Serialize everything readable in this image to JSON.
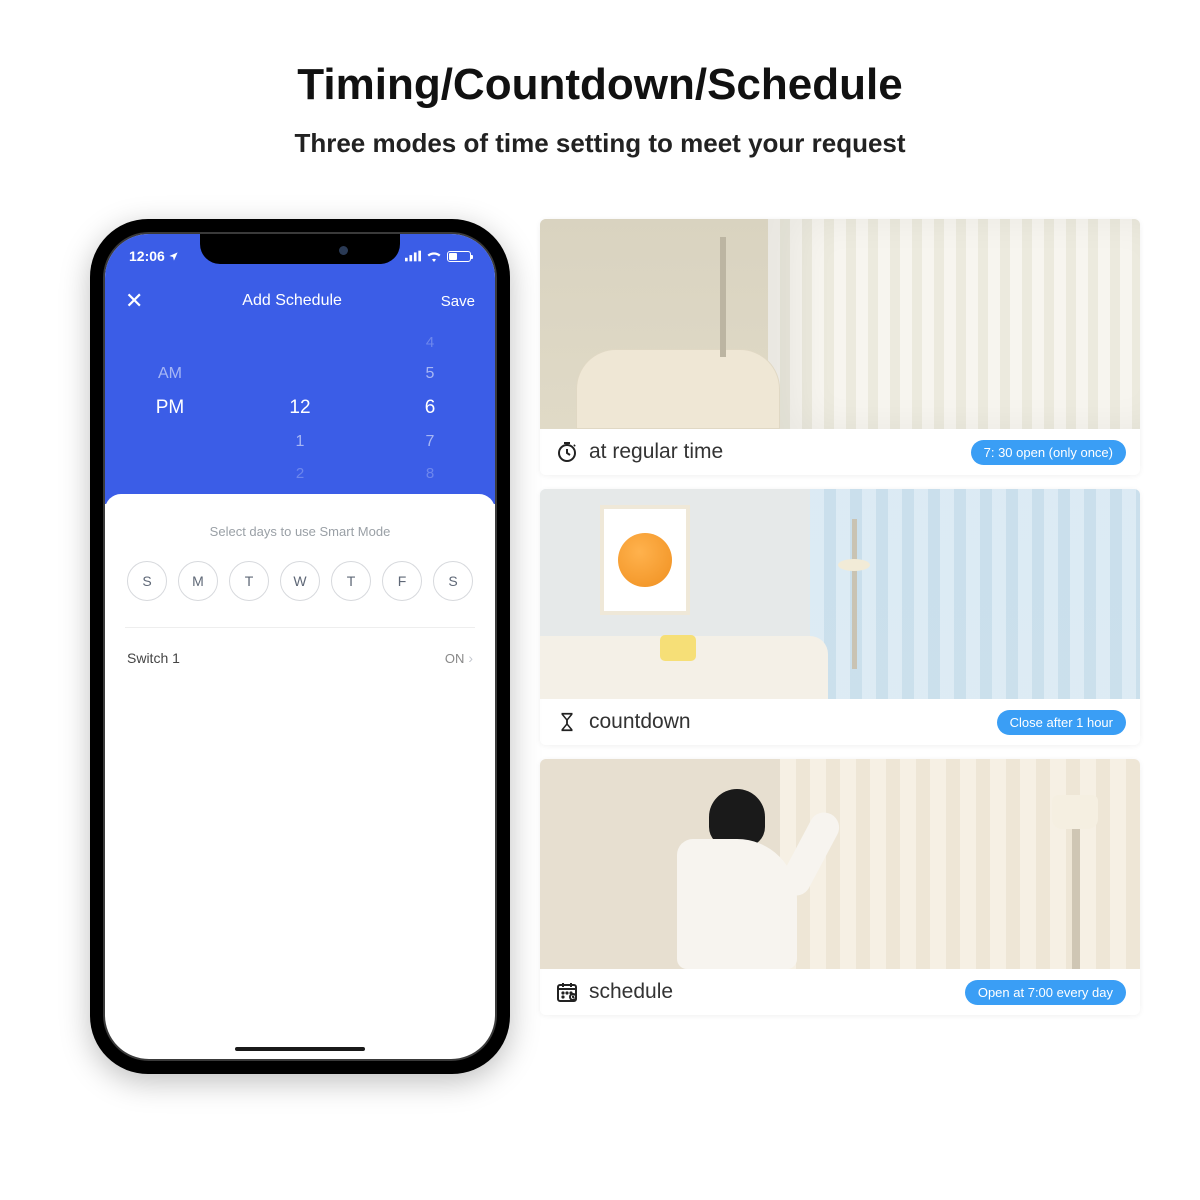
{
  "header": {
    "title": "Timing/Countdown/Schedule",
    "subtitle": "Three modes of time setting to meet your request"
  },
  "phone": {
    "status_time": "12:06",
    "app": {
      "close": "✕",
      "title": "Add Schedule",
      "save": "Save"
    },
    "picker": {
      "am": "AM",
      "pm": "PM",
      "hour_prev": "4",
      "hour_dim": "5",
      "hour_sel": "6",
      "hour_next": "7",
      "hour_next2": "8",
      "mid_sel": "12",
      "mid_next": "1",
      "mid_next2": "2"
    },
    "sheet": {
      "instruction": "Select days to use Smart Mode",
      "days": [
        "S",
        "M",
        "T",
        "W",
        "T",
        "F",
        "S"
      ],
      "switch_label": "Switch 1",
      "switch_state": "ON"
    }
  },
  "cards": [
    {
      "label": "at regular time",
      "badge": "7: 30 open (only once)",
      "icon": "clock-icon"
    },
    {
      "label": "countdown",
      "badge": "Close after 1 hour",
      "icon": "hourglass-icon"
    },
    {
      "label": "schedule",
      "badge": "Open at 7:00 every day",
      "icon": "calendar-icon"
    }
  ]
}
